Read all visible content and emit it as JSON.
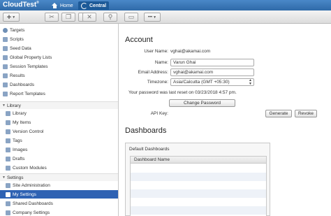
{
  "app": {
    "title": "CloudTest",
    "title_mark": "®",
    "nav": [
      {
        "label": "Home",
        "icon": "home-icon"
      },
      {
        "label": "Central",
        "icon": "central-icon"
      }
    ]
  },
  "toolbar": {
    "buttons": [
      {
        "icon": "add-icon",
        "glyph": "+"
      },
      {
        "icon": "cut-icon",
        "glyph": "✂"
      },
      {
        "icon": "copy-icon",
        "glyph": "❐"
      },
      {
        "icon": "paste-icon",
        "glyph": "▤"
      },
      {
        "icon": "delete-icon",
        "glyph": "✕"
      },
      {
        "icon": "search-icon",
        "glyph": "⚲"
      },
      {
        "icon": "print-icon",
        "glyph": "▭"
      },
      {
        "icon": "more-icon",
        "glyph": "•••"
      }
    ]
  },
  "sidebar": {
    "items": [
      {
        "label": "Targets"
      },
      {
        "label": "Scripts"
      },
      {
        "label": "Seed Data"
      },
      {
        "label": "Global Property Lists"
      },
      {
        "label": "Session Templates"
      },
      {
        "label": "Results"
      },
      {
        "label": "Dashboards"
      },
      {
        "label": "Report Templates"
      }
    ],
    "library_group": "Library",
    "library_items": [
      {
        "label": "Library"
      },
      {
        "label": "My Items"
      },
      {
        "label": "Version Control"
      },
      {
        "label": "Tags"
      },
      {
        "label": "Images"
      },
      {
        "label": "Drafts"
      },
      {
        "label": "Custom Modules"
      }
    ],
    "settings_group": "Settings",
    "settings_items": [
      {
        "label": "Site Administration"
      },
      {
        "label": "My Settings",
        "selected": true
      },
      {
        "label": "Shared Dashboards"
      },
      {
        "label": "Company Settings"
      }
    ]
  },
  "account": {
    "heading": "Account",
    "username_label": "User Name:",
    "username": "vghai@akamai.com",
    "name_label": "Name:",
    "name": "Varun Ghai",
    "email_label": "Email Address:",
    "email": "vghai@akamai.com",
    "timezone_label": "Timezone:",
    "timezone": "Asia/Calcutta (GMT +05:30)",
    "password_note": "Your password was last reset on 03/23/2018 4:57 pm.",
    "change_password": "Change Password",
    "api_key_label": "API Key:",
    "generate": "Generate",
    "revoke": "Revoke"
  },
  "dashboards": {
    "heading": "Dashboards",
    "panel_title": "Default Dashboards",
    "column": "Dashboard Name"
  },
  "colors": {
    "accent": "#2e62b3",
    "topbar": "#3a78b8"
  }
}
